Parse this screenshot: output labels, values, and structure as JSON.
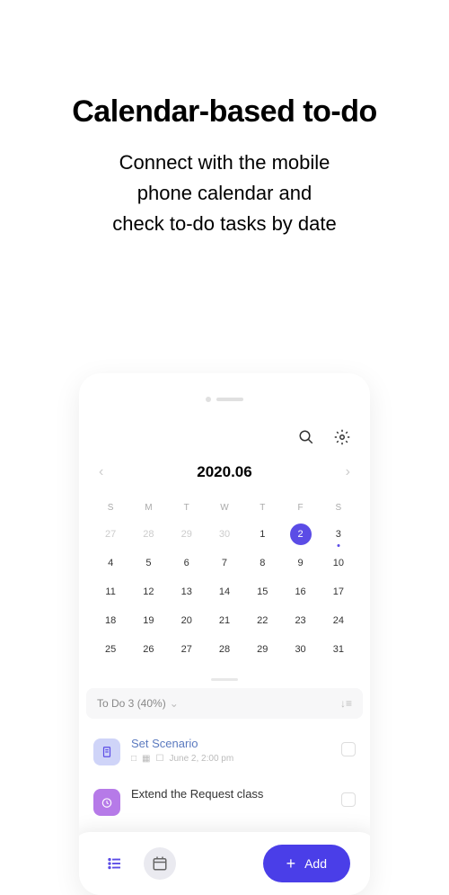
{
  "hero": {
    "title": "Calendar-based to-do",
    "subtitle_line1": "Connect with the mobile",
    "subtitle_line2": "phone calendar and",
    "subtitle_line3": "check to-do tasks by date"
  },
  "calendar": {
    "month_label": "2020.06",
    "day_headers": [
      "S",
      "M",
      "T",
      "W",
      "T",
      "F",
      "S"
    ],
    "weeks": [
      [
        {
          "n": "27",
          "muted": true
        },
        {
          "n": "28",
          "muted": true
        },
        {
          "n": "29",
          "muted": true
        },
        {
          "n": "30",
          "muted": true
        },
        {
          "n": "1"
        },
        {
          "n": "2",
          "selected": true
        },
        {
          "n": "3",
          "dot": true
        }
      ],
      [
        {
          "n": "4"
        },
        {
          "n": "5"
        },
        {
          "n": "6"
        },
        {
          "n": "7"
        },
        {
          "n": "8"
        },
        {
          "n": "9"
        },
        {
          "n": "10"
        }
      ],
      [
        {
          "n": "11"
        },
        {
          "n": "12"
        },
        {
          "n": "13"
        },
        {
          "n": "14"
        },
        {
          "n": "15"
        },
        {
          "n": "16"
        },
        {
          "n": "17"
        }
      ],
      [
        {
          "n": "18"
        },
        {
          "n": "19"
        },
        {
          "n": "20"
        },
        {
          "n": "21"
        },
        {
          "n": "22"
        },
        {
          "n": "23"
        },
        {
          "n": "24"
        }
      ],
      [
        {
          "n": "25"
        },
        {
          "n": "26"
        },
        {
          "n": "27"
        },
        {
          "n": "28"
        },
        {
          "n": "29"
        },
        {
          "n": "30"
        },
        {
          "n": "31"
        }
      ]
    ]
  },
  "todo_section": {
    "header_label": "To Do 3 (40%)"
  },
  "todos": [
    {
      "title": "Set Scenario",
      "meta_date": "June 2, 2:00 pm",
      "icon_color": "blue",
      "link_style": true
    },
    {
      "title": "Extend the Request class",
      "meta_date": "",
      "icon_color": "purple",
      "link_style": false
    }
  ],
  "bottom_bar": {
    "add_label": "Add"
  }
}
